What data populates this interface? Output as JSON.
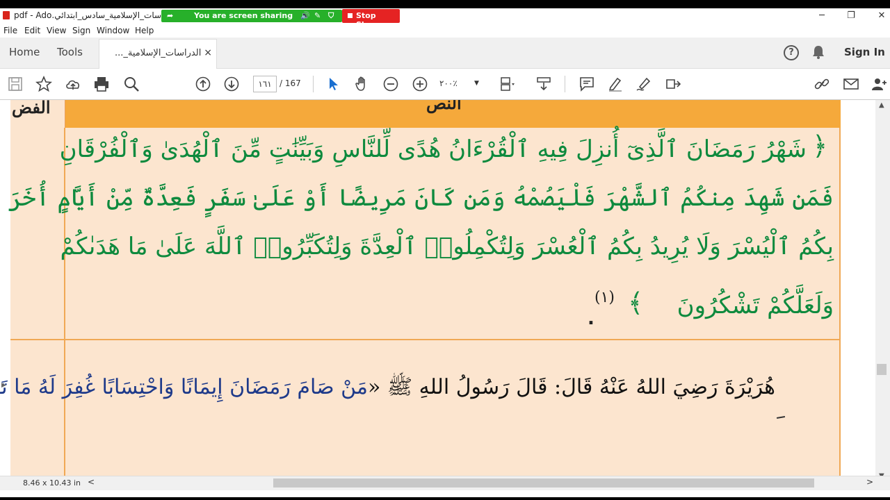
{
  "window": {
    "title": "الدراسات_الإسلامية_سادس_ابتدائي.pdf - Ado",
    "minimize": "─",
    "restore": "❐",
    "close": "✕"
  },
  "screen_share": {
    "status": "You are screen sharing",
    "stop_label": "Stop Share"
  },
  "menu": [
    "File",
    "Edit",
    "View",
    "Sign",
    "Window",
    "Help"
  ],
  "tabs": {
    "home": "Home",
    "tools": "Tools",
    "document": "الدراسات_الإسلامية_...",
    "close": "×"
  },
  "header_actions": {
    "help": "?",
    "signin": "Sign In"
  },
  "toolbar": {
    "page_current": "١٦١",
    "page_total": "/  167",
    "zoom": "٢٠٠٪",
    "zoom_caret": "▼"
  },
  "document": {
    "header_left": "الفض",
    "header_title": "النص",
    "verse_lines": [
      "شَهْرُ رَمَضَانَ ٱلَّذِىٓ أُنزِلَ فِيهِ ٱلْقُرْءَانُ هُدًى لِّلنَّاسِ وَبَيِّنَٰتٍ مِّنَ ٱلْهُدَىٰ وَٱلْفُرْقَانِ",
      "فَمَن شَهِدَ مِنكُمُ ٱلشَّهْرَ فَلْيَصُمْهُ وَمَن كَانَ مَرِيضًا أَوْ عَلَىٰ سَفَرٍ فَعِدَّةٌ مِّنْ أَيَّامٍ أُخَرَ يُرِيدُ ٱللَّهُ",
      "بِكُمُ ٱلْيُسْرَ وَلَا يُرِيدُ بِكُمُ ٱلْعُسْرَ وَلِتُكْمِلُوا۟ ٱلْعِدَّةَ وَلِتُكَبِّرُوا۟ ٱللَّهَ عَلَىٰ مَا هَدَىٰكُمْ",
      "وَلَعَلَّكُمْ تَشْكُرُونَ"
    ],
    "orn_open": "﴿",
    "orn_close": "﴾",
    "footnote": "(١)",
    "period": ".",
    "hadith_black": "هُرَيْرَةَ رَضِيَ اللهُ عَنْهُ قَالَ: قَالَ رَسُولُ اللهِ ﷺ «",
    "hadith_blue": "مَنْ صَامَ رَمَضَانَ إِيمَانًا وَاحْتِسَابًا غُفِرَ لَهُ مَا تَقَدَّمَ"
  },
  "status": {
    "page_size": "8.46 x 10.43 in",
    "scroll_left": "<",
    "scroll_right": ">",
    "scroll_up": "▲",
    "scroll_down": "▼",
    "side_arrow": "▶"
  },
  "colors": {
    "verse_green": "#0e8a3e",
    "header_orange": "#f5a93b",
    "page_bg": "#fce5cf",
    "hadith_blue": "#1e3a8a",
    "share_green": "#27b02a",
    "stop_red": "#e52323"
  }
}
